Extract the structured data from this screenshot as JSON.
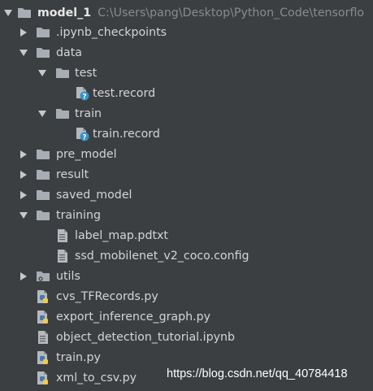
{
  "tree": {
    "root": {
      "name": "model_1",
      "path": "C:\\Users\\pang\\Desktop\\Python_Code\\tensorflo",
      "icon": "folder-icon",
      "expanded": true
    },
    "items": [
      {
        "label": ".ipynb_checkpoints",
        "icon": "folder-icon",
        "expanded": false
      },
      {
        "label": "data",
        "icon": "folder-icon",
        "expanded": true
      },
      {
        "label": "test",
        "icon": "folder-icon",
        "expanded": true
      },
      {
        "label": "test.record",
        "icon": "unknown-file-icon"
      },
      {
        "label": "train",
        "icon": "folder-icon",
        "expanded": true
      },
      {
        "label": "train.record",
        "icon": "unknown-file-icon"
      },
      {
        "label": "pre_model",
        "icon": "folder-icon",
        "expanded": false
      },
      {
        "label": "result",
        "icon": "folder-icon",
        "expanded": false
      },
      {
        "label": "saved_model",
        "icon": "folder-icon",
        "expanded": false
      },
      {
        "label": "training",
        "icon": "folder-icon",
        "expanded": true
      },
      {
        "label": "label_map.pdtxt",
        "icon": "text-file-icon"
      },
      {
        "label": "ssd_mobilenet_v2_coco.config",
        "icon": "text-file-icon"
      },
      {
        "label": "utils",
        "icon": "package-folder-icon",
        "expanded": false
      },
      {
        "label": "cvs_TFRecords.py",
        "icon": "python-file-icon"
      },
      {
        "label": "export_inference_graph.py",
        "icon": "python-file-icon"
      },
      {
        "label": "object_detection_tutorial.ipynb",
        "icon": "text-file-icon"
      },
      {
        "label": "train.py",
        "icon": "python-file-icon"
      },
      {
        "label": "xml_to_csv.py",
        "icon": "python-file-icon"
      }
    ]
  },
  "watermark": "https://blog.csdn.net/qq_40784418",
  "colors": {
    "background": "#3c3f41",
    "text": "#d4d4d4",
    "folder": "#a8adb4",
    "path_text": "#8a8a8a",
    "python_blue": "#3f7cb8",
    "python_yellow": "#f2c94c",
    "unknown_badge": "#3592c4"
  }
}
